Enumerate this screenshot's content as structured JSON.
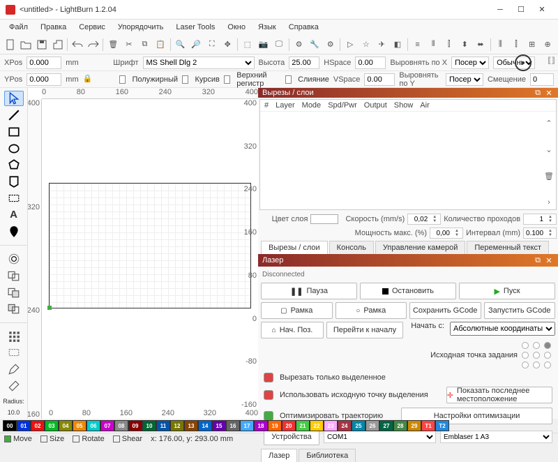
{
  "window": {
    "title": "<untitled> - LightBurn 1.2.04"
  },
  "menu": [
    "Файл",
    "Правка",
    "Сервис",
    "Упорядочить",
    "Laser Tools",
    "Окно",
    "Язык",
    "Справка"
  ],
  "posbar": {
    "xlabel": "XPos",
    "xval": "0.000",
    "xunit": "mm",
    "ylabel": "YPos",
    "yval": "0.000",
    "yunit": "mm"
  },
  "fontbar": {
    "fontlbl": "Шрифт",
    "font": "MS Shell Dlg 2",
    "heightlbl": "Высота",
    "height": "25.00",
    "hspacelbl": "HSpace",
    "hspace": "0.00",
    "alignxlbl": "Выровнять по X",
    "alignx": "Посере",
    "stylelbl": "Обычный",
    "boldlbl": "Полужирный",
    "italiclbl": "Курсив",
    "upperlbl": "Верхний регистр",
    "mergelbl": "Слияние",
    "vspacelbl": "VSpace",
    "vspace": "0.00",
    "alignylbl": "Выровнять по Y",
    "aligny": "Посере",
    "offsetlbl": "Смещение",
    "offset": "0"
  },
  "ruler_x": [
    "0",
    "80",
    "160",
    "240",
    "320",
    "400"
  ],
  "ruler_y": [
    "400",
    "320",
    "240",
    "160",
    "80",
    "0",
    "-80",
    "-160"
  ],
  "ruler_x2": [
    "0",
    "80",
    "160",
    "240",
    "320",
    "400"
  ],
  "ruler_y2": [
    "400",
    "320",
    "240",
    "-160"
  ],
  "layers": {
    "title": "Вырезы / слои",
    "cols": [
      "#",
      "Layer",
      "Mode",
      "Spd/Pwr",
      "Output",
      "Show",
      "Air"
    ],
    "colorlbl": "Цвет слоя",
    "speedlbl": "Скорость (mm/s)",
    "speed": "0,02",
    "passeslbl": "Количество проходов",
    "passes": "1",
    "powerlbl": "Мощность макс. (%)",
    "power": "0,00",
    "intervallbl": "Интервал (mm)",
    "interval": "0.100"
  },
  "tabs": [
    "Вырезы / слои",
    "Консоль",
    "Управление камерой",
    "Переменный текст"
  ],
  "laser": {
    "title": "Лазер",
    "status": "Disconnected",
    "pause": "Пауза",
    "stop": "Остановить",
    "start": "Пуск",
    "frame": "Рамка",
    "frame2": "Рамка",
    "savegcode": "Сохранить GCode",
    "rungcode": "Запустить GCode",
    "home": "Нач. Поз.",
    "gostart": "Перейти к началу",
    "startfrom": "Начать с:",
    "startmode": "Абсолютные координаты",
    "joborigin": "Исходная точка задания",
    "cutsel": "Вырезать только выделенное",
    "usesel": "Использовать исходную точку выделения",
    "showlast": "Показать последнее местоположение",
    "optpath": "Оптимизировать траекторию",
    "optset": "Настройки оптимизации",
    "devices": "Устройства",
    "port": "COM1",
    "device": "Emblaser 1 A3"
  },
  "bottomtabs": [
    "Лазер",
    "Библиотека"
  ],
  "palette_labels": [
    "00",
    "01",
    "02",
    "03",
    "04",
    "05",
    "06",
    "07",
    "08",
    "09",
    "10",
    "11",
    "12",
    "13",
    "14",
    "15",
    "16",
    "17",
    "18",
    "19",
    "20",
    "21",
    "22",
    "23",
    "24",
    "25",
    "26",
    "27",
    "28",
    "29",
    "T1",
    "T2"
  ],
  "palette_colors": [
    "#000",
    "#03d",
    "#e11",
    "#0b2",
    "#880",
    "#e80",
    "#0cc",
    "#c0c",
    "#888",
    "#800",
    "#063",
    "#05a",
    "#770",
    "#840",
    "#06c",
    "#60a",
    "#666",
    "#4af",
    "#a0c",
    "#f60",
    "#e33",
    "#4c4",
    "#fc0",
    "#faf",
    "#a34",
    "#08a",
    "#999",
    "#064",
    "#484",
    "#c80",
    "#f44",
    "#28d"
  ],
  "status": {
    "move": "Move",
    "size": "Size",
    "rotate": "Rotate",
    "shear": "Shear",
    "coords": "x: 176.00, y: 293.00 mm"
  },
  "radius": {
    "label": "Radius:",
    "val": "10.0"
  }
}
